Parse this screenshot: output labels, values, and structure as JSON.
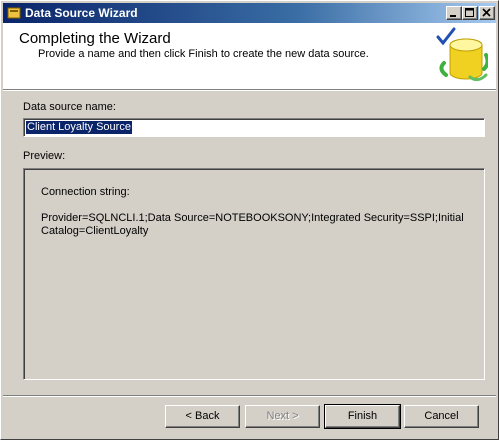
{
  "window": {
    "title": "Data Source Wizard",
    "buttons": [
      "minimize",
      "maximize",
      "close"
    ]
  },
  "header": {
    "title": "Completing the Wizard",
    "subtitle": "Provide a name and then click Finish to create the new data source."
  },
  "form": {
    "name_label": "Data source name:",
    "name_value": "Client Loyalty Source",
    "preview_label": "Preview:",
    "connection_label": "Connection string:",
    "connection_value": "Provider=SQLNCLI.1;Data Source=NOTEBOOKSONY;Integrated Security=SSPI;Initial Catalog=ClientLoyalty"
  },
  "footer": {
    "back_label": "< Back",
    "next_label": "Next >",
    "finish_label": "Finish",
    "cancel_label": "Cancel"
  },
  "colors": {
    "titlebar_start": "#0a246a",
    "titlebar_end": "#a6caf0",
    "face": "#d4d0c8",
    "selection": "#0a246a"
  },
  "icons": {
    "app": "data-source-icon",
    "header_graphic": "database-check-icon"
  }
}
